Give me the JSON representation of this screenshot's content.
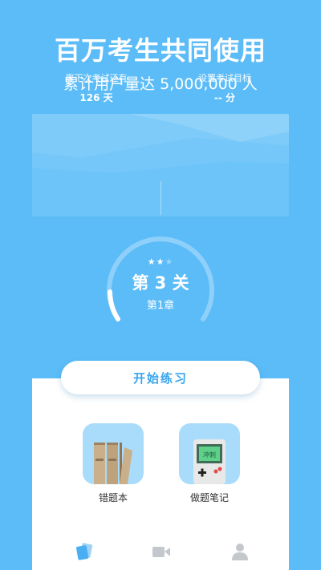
{
  "hero": {
    "headline": "百万考生共同使用",
    "subline": "累计用户量达 5,000,000 人"
  },
  "stats": {
    "countdown_label": "离下次考试还有",
    "countdown_value": "126 天",
    "target_label": "设置考试目标",
    "target_value": "-- 分"
  },
  "progress": {
    "stars_filled": 2,
    "stars_total": 3,
    "level": "第 3 关",
    "chapter": "第1章"
  },
  "actions": {
    "start_label": "开始练习",
    "mistakes_label": "错题本",
    "notes_label": "做题笔记",
    "notes_screen_text": "冲刺"
  },
  "colors": {
    "background": "#5bbcf7",
    "accent": "#38a5ef",
    "tile": "#a9dcfb"
  },
  "nav": {
    "items": [
      "cards-icon",
      "video-icon",
      "user-icon"
    ],
    "active": "cards-icon"
  }
}
